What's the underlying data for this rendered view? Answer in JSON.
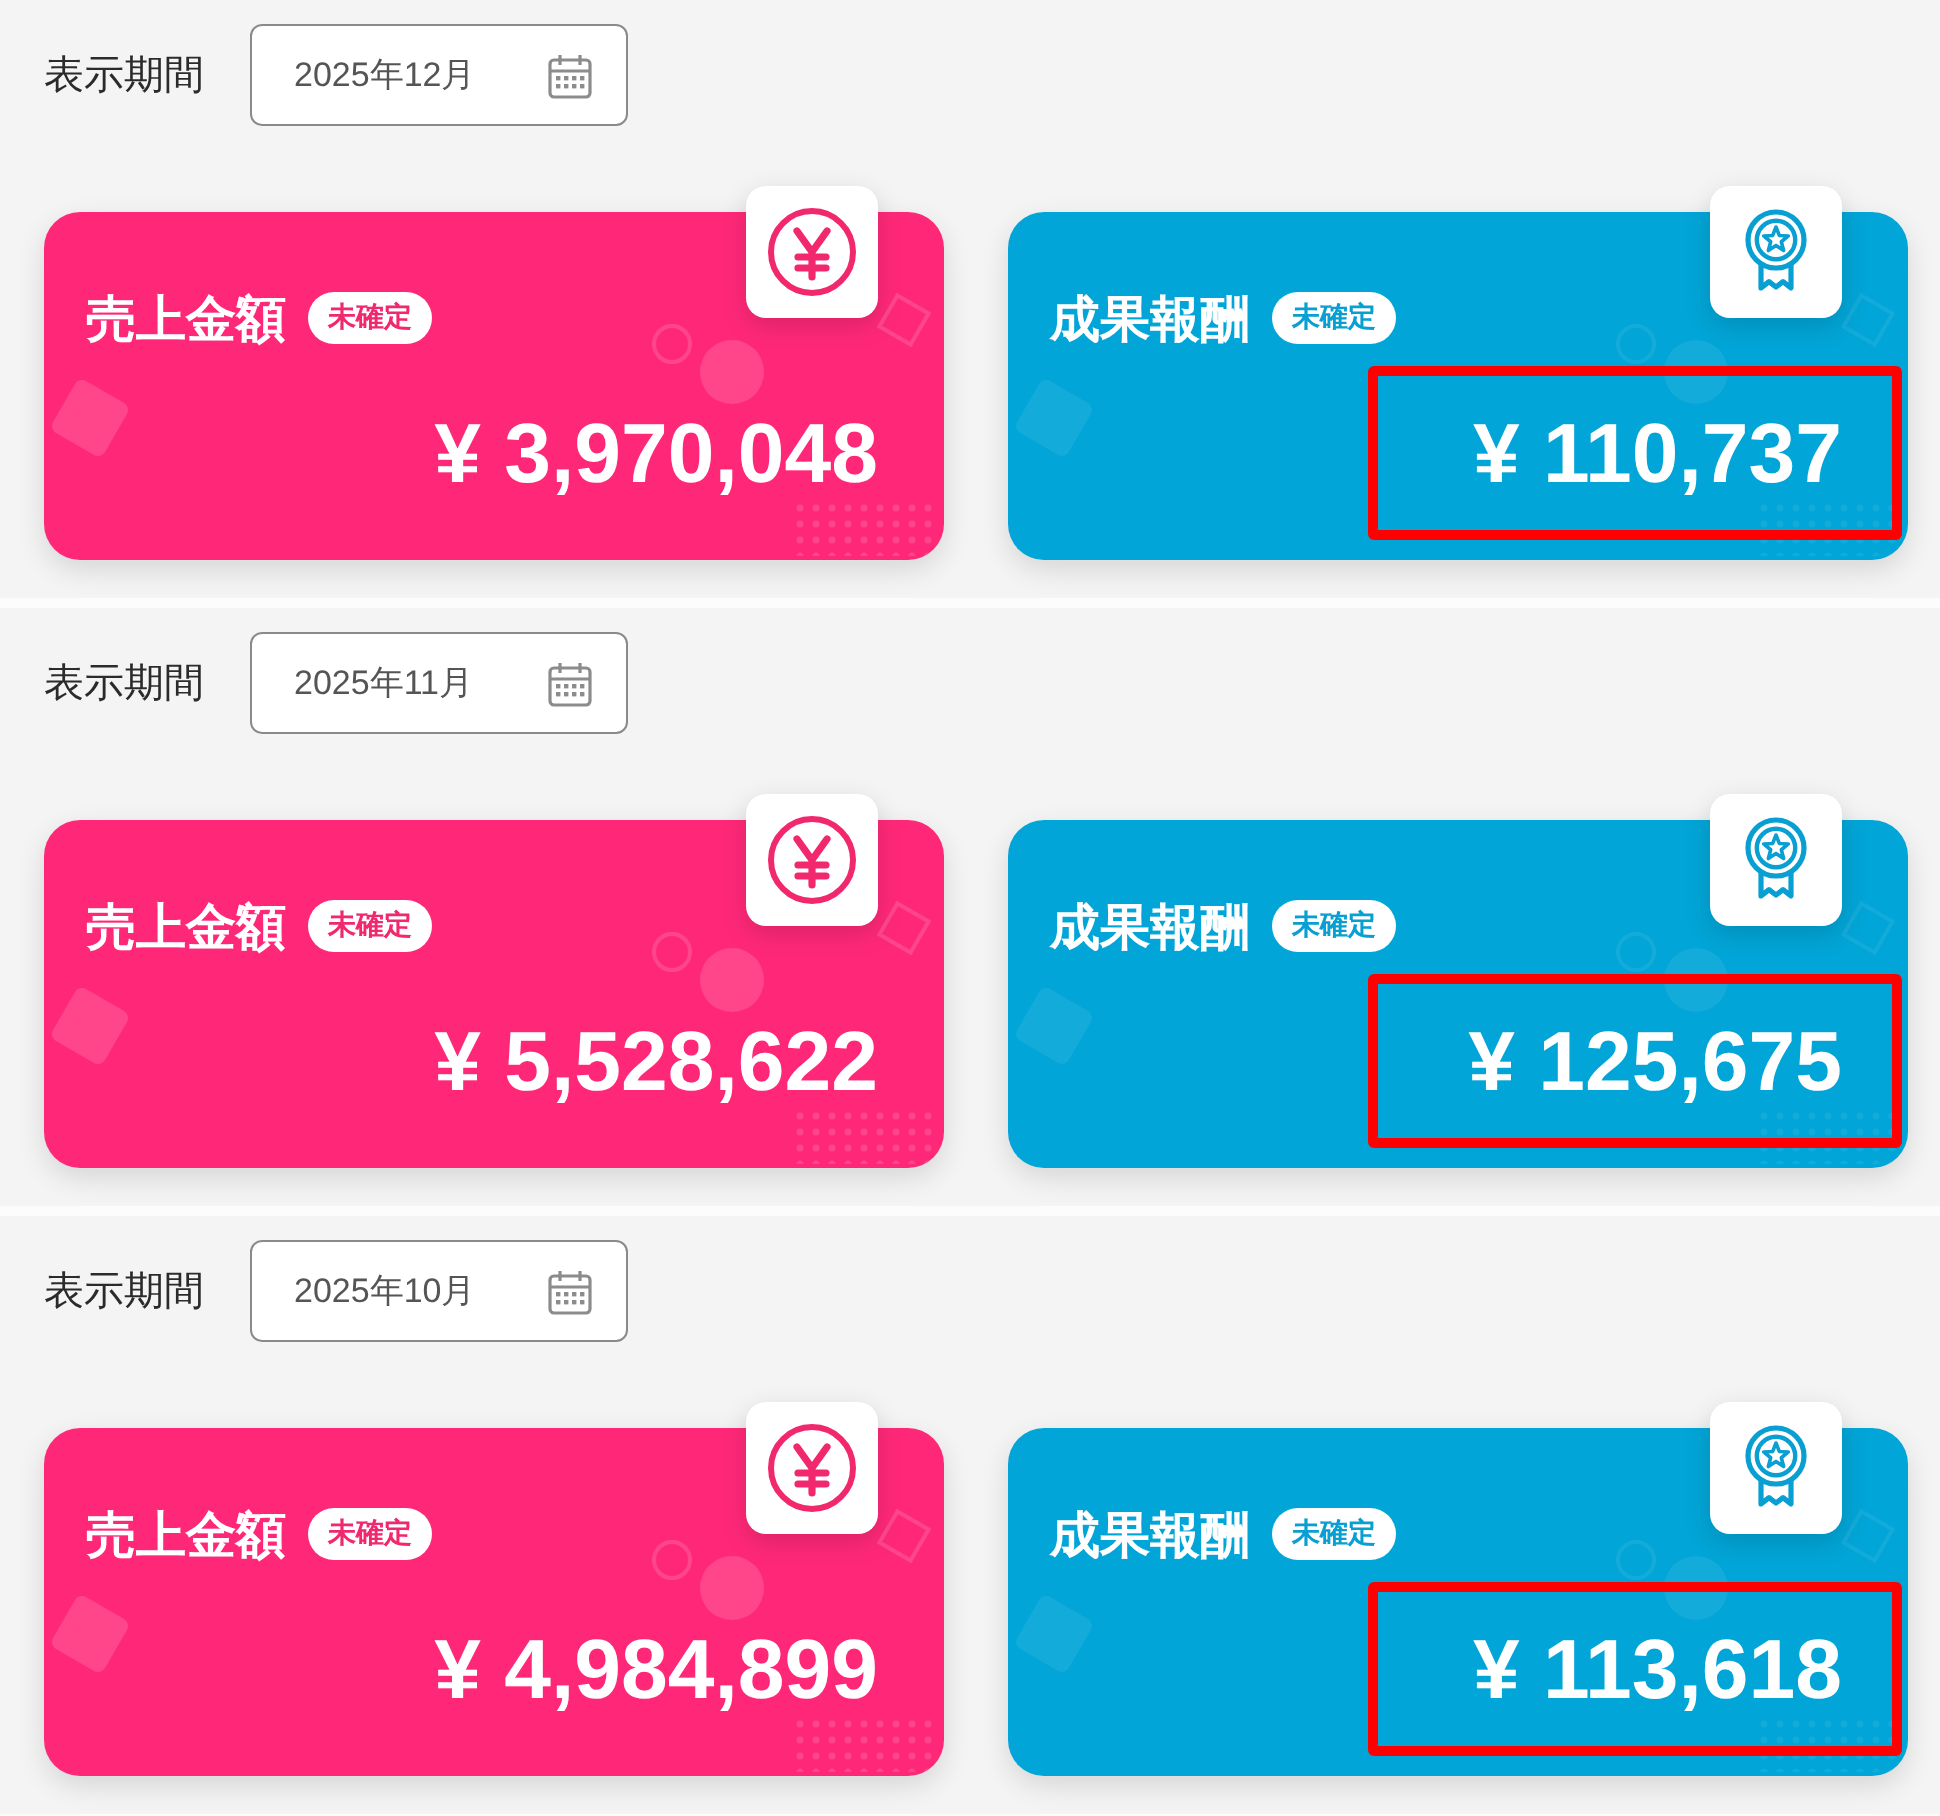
{
  "periods": [
    {
      "label": "表示期間",
      "month_picker": {
        "value": "2025年12月"
      },
      "cards": [
        {
          "kind": "sales",
          "title": "売上金額",
          "badge": "未確定",
          "amount": "¥ 3,970,048",
          "highlighted": false
        },
        {
          "kind": "reward",
          "title": "成果報酬",
          "badge": "未確定",
          "amount": "¥ 110,737",
          "highlighted": true
        }
      ]
    },
    {
      "label": "表示期間",
      "month_picker": {
        "value": "2025年11月"
      },
      "cards": [
        {
          "kind": "sales",
          "title": "売上金額",
          "badge": "未確定",
          "amount": "¥ 5,528,622",
          "highlighted": false
        },
        {
          "kind": "reward",
          "title": "成果報酬",
          "badge": "未確定",
          "amount": "¥ 125,675",
          "highlighted": true
        }
      ]
    },
    {
      "label": "表示期間",
      "month_picker": {
        "value": "2025年10月"
      },
      "cards": [
        {
          "kind": "sales",
          "title": "売上金額",
          "badge": "未確定",
          "amount": "¥ 4,984,899",
          "highlighted": false
        },
        {
          "kind": "reward",
          "title": "成果報酬",
          "badge": "未確定",
          "amount": "¥ 113,618",
          "highlighted": true
        }
      ]
    }
  ]
}
